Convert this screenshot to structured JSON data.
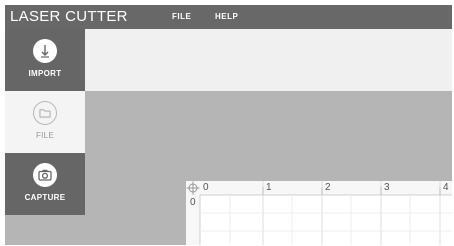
{
  "app": {
    "title": "LASER CUTTER"
  },
  "menu": {
    "items": [
      {
        "label": "FILE"
      },
      {
        "label": "HELP"
      }
    ]
  },
  "sidebar": {
    "items": [
      {
        "label": "IMPORT",
        "icon": "import-icon"
      },
      {
        "label": "FILE",
        "icon": "folder-icon"
      },
      {
        "label": "CAPTURE",
        "icon": "camera-icon"
      }
    ]
  },
  "canvas": {
    "ruler_x": [
      "0",
      "1",
      "2",
      "3",
      "4"
    ],
    "ruler_y": [
      "0"
    ],
    "origin_icon": "crosshair-icon"
  },
  "colors": {
    "topbar": "#686868",
    "sidebar_dark": "#666666",
    "sidebar_light": "#f4f4f4",
    "workspace": "#b5b5b5",
    "canvas": "#ffffff"
  }
}
